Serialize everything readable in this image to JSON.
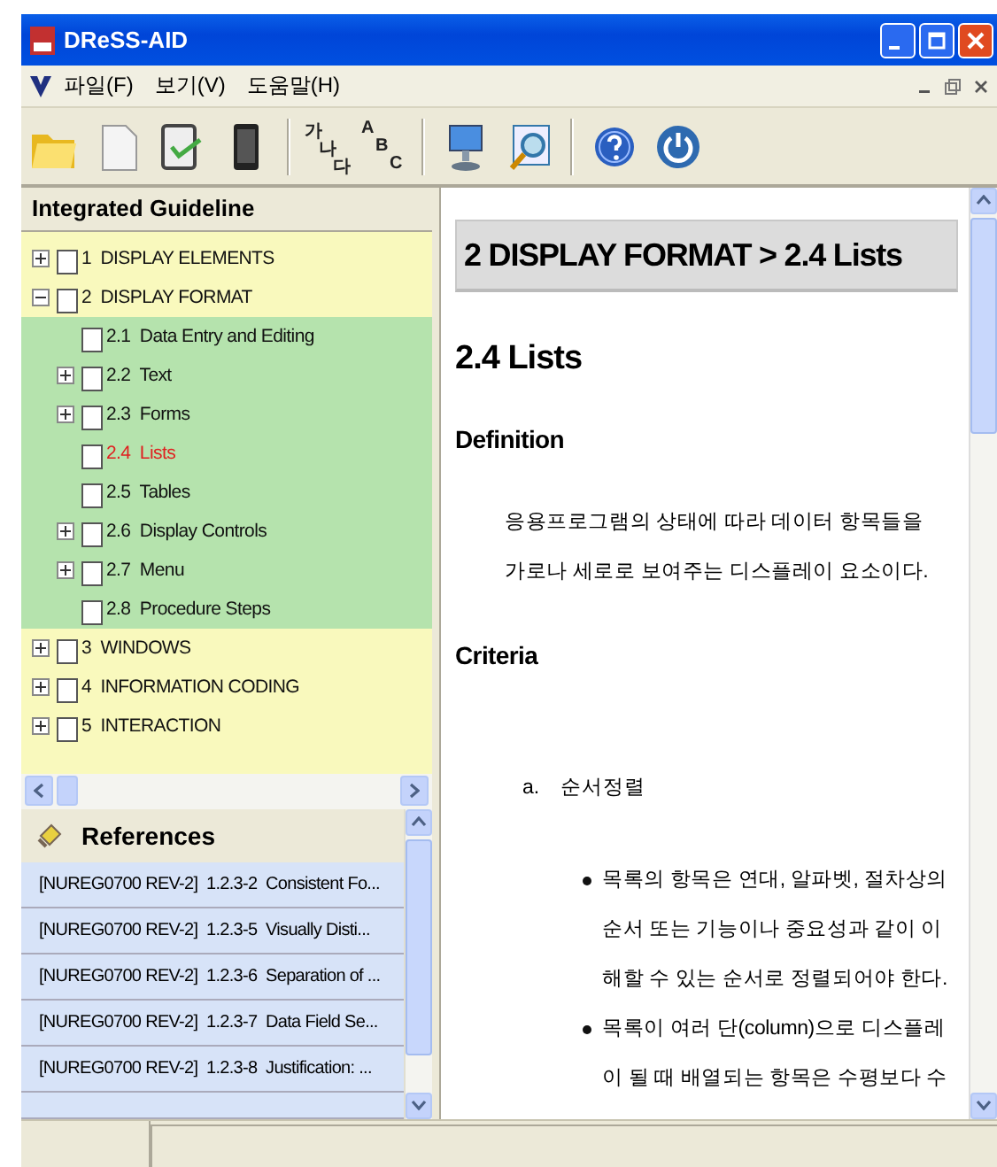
{
  "window": {
    "title": "DReSS-AID"
  },
  "menu": [
    "파일(F)",
    "보기(V)",
    "도움말(H)"
  ],
  "toolbar": [
    {
      "kind": "folder"
    },
    {
      "kind": "file"
    },
    {
      "kind": "check"
    },
    {
      "kind": "device"
    },
    {
      "kind": "sep"
    },
    {
      "kind": "hangul",
      "text": [
        "가",
        "나",
        "다"
      ]
    },
    {
      "kind": "abc",
      "text": [
        "A",
        "B",
        "C"
      ]
    },
    {
      "kind": "sep"
    },
    {
      "kind": "monitor"
    },
    {
      "kind": "search"
    },
    {
      "kind": "sep"
    },
    {
      "kind": "help"
    },
    {
      "kind": "power"
    }
  ],
  "tree": {
    "title": "Integrated Guideline",
    "items": [
      {
        "label": "1  DISPLAY ELEMENTS",
        "expanded": false,
        "checked": false,
        "selected": false
      },
      {
        "label": "2  DISPLAY FORMAT",
        "expanded": true,
        "checked": false,
        "selected": false,
        "children": [
          {
            "label": "2.1  Data Entry and Editing",
            "checked": false,
            "selected": false
          },
          {
            "label": "2.2  Text",
            "expanded": false,
            "checked": false,
            "selected": false
          },
          {
            "label": "2.3  Forms",
            "expanded": false,
            "checked": false,
            "selected": false
          },
          {
            "label": "2.4  Lists",
            "checked": false,
            "selected": true
          },
          {
            "label": "2.5  Tables",
            "checked": false,
            "selected": false
          },
          {
            "label": "2.6  Display Controls",
            "expanded": false,
            "checked": false,
            "selected": false
          },
          {
            "label": "2.7  Menu",
            "expanded": false,
            "checked": false,
            "selected": false
          },
          {
            "label": "2.8  Procedure Steps",
            "checked": false,
            "selected": false
          }
        ]
      },
      {
        "label": "3  WINDOWS",
        "expanded": false,
        "checked": false,
        "selected": false
      },
      {
        "label": "4  INFORMATION CODING",
        "expanded": false,
        "checked": false,
        "selected": false
      },
      {
        "label": "5  INTERACTION",
        "expanded": false,
        "checked": false,
        "selected": false
      }
    ]
  },
  "references": {
    "title": "References",
    "rows": [
      "[NUREG0700 REV-2]  1.2.3-2  Consistent Fo...",
      "[NUREG0700 REV-2]  1.2.3-5  Visually Disti...",
      "[NUREG0700 REV-2]  1.2.3-6  Separation of ...",
      "[NUREG0700 REV-2]  1.2.3-7  Data Field Se...",
      "[NUREG0700 REV-2]  1.2.3-8  Justification: ..."
    ]
  },
  "content": {
    "breadcrumb": "2 DISPLAY FORMAT > 2.4 Lists",
    "heading": "2.4 Lists",
    "blocks": [
      {
        "kind": "subheading",
        "text": "Definition"
      },
      {
        "kind": "paragraph",
        "text": "응용프로그램의 상태에 따라 데이터 항목들을 가로나 세로로 보여주는 디스플레이 요소이다."
      },
      {
        "kind": "subheading",
        "text": "Criteria"
      },
      {
        "kind": "criterion",
        "marker": "a.",
        "text": "순서정렬"
      },
      {
        "kind": "bullet",
        "text": "목록의 항목은 연대, 알파벳, 절차상의 순서 또는 기능이나 중요성과 같이 이해할 수 있는 순서로 정렬되어야 한다."
      },
      {
        "kind": "bullet",
        "text": "목록이 여러 단(column)으로 디스플레이 될 때 배열되는 항목은 수평보다 수"
      }
    ]
  }
}
